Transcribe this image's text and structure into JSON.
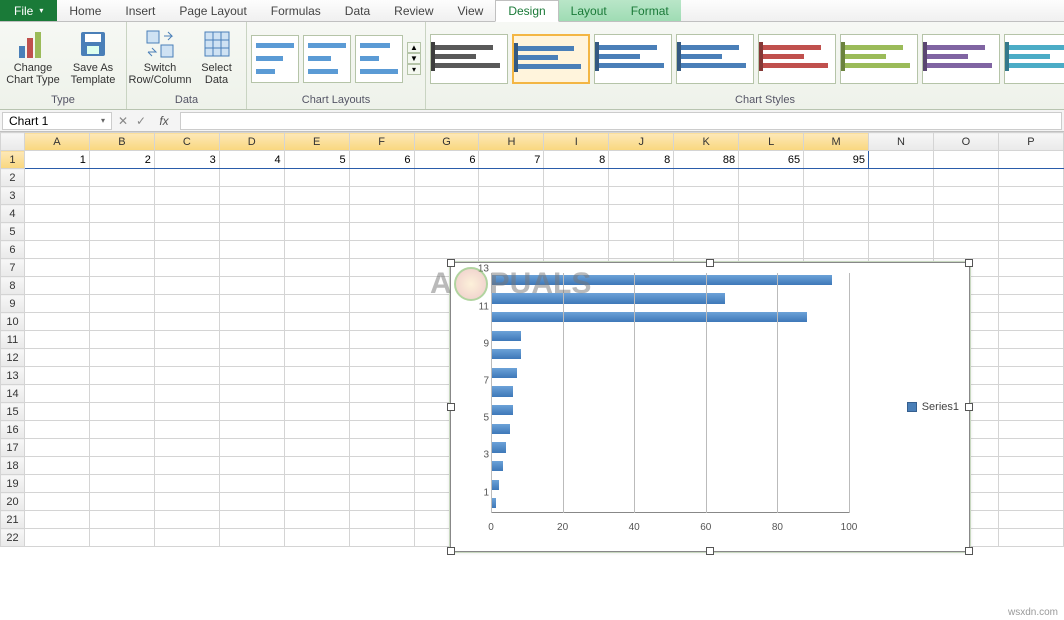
{
  "tabs": {
    "file": "File",
    "list": [
      "Home",
      "Insert",
      "Page Layout",
      "Formulas",
      "Data",
      "Review",
      "View"
    ],
    "contextual": [
      "Design",
      "Layout",
      "Format"
    ],
    "active": "Design"
  },
  "ribbon": {
    "type": {
      "label": "Type",
      "change": "Change Chart Type",
      "save_tpl": "Save As Template"
    },
    "data": {
      "label": "Data",
      "switch": "Switch Row/Column",
      "select": "Select Data"
    },
    "layouts": {
      "label": "Chart Layouts"
    },
    "styles": {
      "label": "Chart Styles",
      "colors": [
        "#595959",
        "#4a7fb8",
        "#4a7fb8",
        "#4a7fb8",
        "#c0504d",
        "#9bbb59",
        "#8064a2",
        "#4bacc6"
      ]
    }
  },
  "formula_bar": {
    "name_box": "Chart 1",
    "fx": "fx",
    "value": ""
  },
  "grid": {
    "columns": [
      "A",
      "B",
      "C",
      "D",
      "E",
      "F",
      "G",
      "H",
      "I",
      "J",
      "K",
      "L",
      "M",
      "N",
      "O",
      "P"
    ],
    "rows": 22,
    "row1": [
      "1",
      "2",
      "3",
      "4",
      "5",
      "6",
      "6",
      "7",
      "8",
      "8",
      "88",
      "65",
      "95",
      "",
      "",
      ""
    ],
    "selected_cols": 13
  },
  "chart_data": {
    "type": "bar",
    "orientation": "horizontal",
    "series": [
      {
        "name": "Series1",
        "values": [
          1,
          2,
          3,
          4,
          5,
          6,
          6,
          7,
          8,
          8,
          88,
          65,
          95
        ]
      }
    ],
    "categories": [
      1,
      2,
      3,
      4,
      5,
      6,
      7,
      8,
      9,
      10,
      11,
      12,
      13
    ],
    "y_axis_tick_labels": [
      1,
      3,
      5,
      7,
      9,
      11,
      13
    ],
    "x_axis_ticks": [
      0,
      20,
      40,
      60,
      80,
      100
    ],
    "xlim": [
      0,
      100
    ],
    "legend": "Series1"
  },
  "watermark": {
    "prefix": "A",
    "suffix": "PUALS"
  },
  "footer": "wsxdn.com"
}
